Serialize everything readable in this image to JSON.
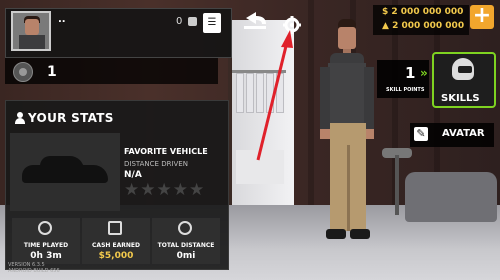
{
  "profile": {
    "name": "..",
    "trophy_count": "0",
    "book_icon": "book-icon"
  },
  "level": {
    "value": "1"
  },
  "stats": {
    "title": "YOUR STATS",
    "favorite_vehicle_label": "FAVORITE VEHICLE",
    "distance_driven_label": "DISTANCE DRIVEN",
    "distance_driven_value": "N/A",
    "rating": 0,
    "time_played_label": "TIME PLAYED",
    "time_played_value": "0h 3m",
    "cash_earned_label": "CASH EARNED",
    "cash_earned_value": "$5,000",
    "total_distance_label": "TOTAL DISTANCE",
    "total_distance_value": "0mi"
  },
  "version": {
    "line1": "VERSION 6.3.5",
    "line2": "ANDROID BUILD 656"
  },
  "currency": {
    "money": "$ 2 000 000 000",
    "gold": "2 000 000 000",
    "plus_label": "+"
  },
  "skills": {
    "points": "1",
    "points_label": "SKILL POINTS",
    "button_label": "SKILLS"
  },
  "avatar": {
    "button_label": "AVATAR"
  },
  "colors": {
    "accent_green": "#7ed321",
    "money_gold": "#f2c94c",
    "plus_orange": "#f2a62d",
    "annotation_red": "#e0212b"
  }
}
